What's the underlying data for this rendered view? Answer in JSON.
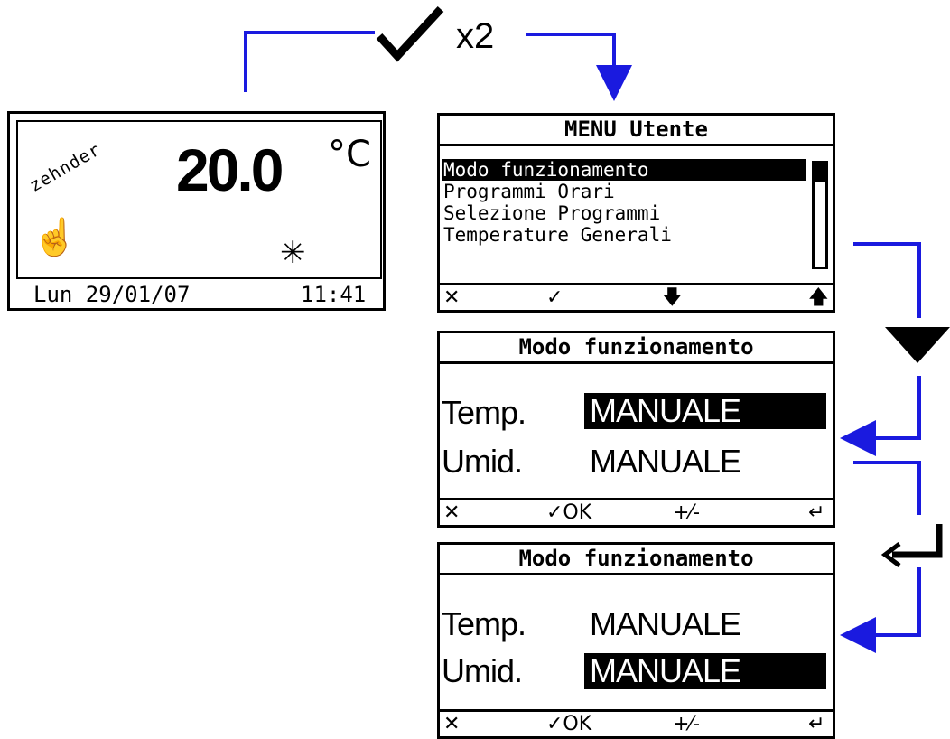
{
  "colors": {
    "connector": "#1a1adf",
    "lcd_ink": "#000000",
    "lcd_bg": "#ffffff"
  },
  "press_twice": {
    "icon": "check-icon",
    "label": "x2"
  },
  "home_screen": {
    "brand": "zehnder",
    "temperature": "20.0",
    "unit": "°C",
    "mode_icon": "hand-icon",
    "season_icon": "snowflake-icon",
    "date": "Lun 29/01/07",
    "time": "11:41"
  },
  "user_menu": {
    "title": "MENU Utente",
    "items": [
      {
        "label": "Modo funzionamento",
        "selected": true
      },
      {
        "label": "Programmi Orari",
        "selected": false
      },
      {
        "label": "Selezione Programmi",
        "selected": false
      },
      {
        "label": "Temperature Generali",
        "selected": false
      }
    ],
    "softkeys": {
      "cancel": "✕",
      "confirm": "✓",
      "down": "🡇",
      "up": "🡅"
    }
  },
  "mode_screen_temp": {
    "title": "Modo funzionamento",
    "rows": [
      {
        "label": "Temp.",
        "value": "MANUALE",
        "selected": true
      },
      {
        "label": "Umid.",
        "value": "MANUALE",
        "selected": false
      }
    ],
    "softkeys": {
      "cancel": "✕",
      "ok": "✓OK",
      "plusminus": "+⁄-",
      "enter": "↵"
    }
  },
  "mode_screen_humid": {
    "title": "Modo funzionamento",
    "rows": [
      {
        "label": "Temp.",
        "value": "MANUALE",
        "selected": false
      },
      {
        "label": "Umid.",
        "value": "MANUALE",
        "selected": true
      }
    ],
    "softkeys": {
      "cancel": "✕",
      "ok": "✓OK",
      "plusminus": "+⁄-",
      "enter": "↵"
    }
  },
  "side_icons": {
    "down": "down-triangle-icon",
    "enter": "enter-key-icon"
  }
}
